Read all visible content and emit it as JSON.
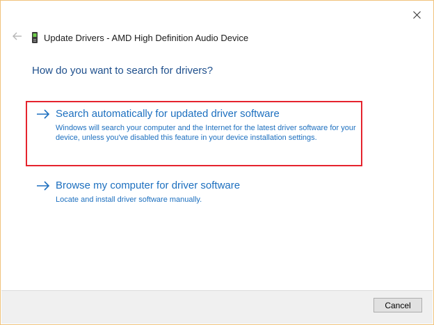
{
  "window": {
    "title": "Update Drivers - AMD High Definition Audio Device",
    "back_icon": "back-arrow-icon",
    "close_icon": "close-icon",
    "device_icon": "audio-device-icon"
  },
  "main": {
    "heading": "How do you want to search for drivers?",
    "options": [
      {
        "title": "Search automatically for updated driver software",
        "description": "Windows will search your computer and the Internet for the latest driver software for your device, unless you've disabled this feature in your device installation settings.",
        "icon": "arrow-right-icon"
      },
      {
        "title": "Browse my computer for driver software",
        "description": "Locate and install driver software manually.",
        "icon": "arrow-right-icon"
      }
    ]
  },
  "footer": {
    "cancel_label": "Cancel"
  },
  "colors": {
    "link": "#1c6fbf",
    "heading": "#1e4f8c",
    "highlight": "#e5232d",
    "window_border": "#f0c27a"
  }
}
